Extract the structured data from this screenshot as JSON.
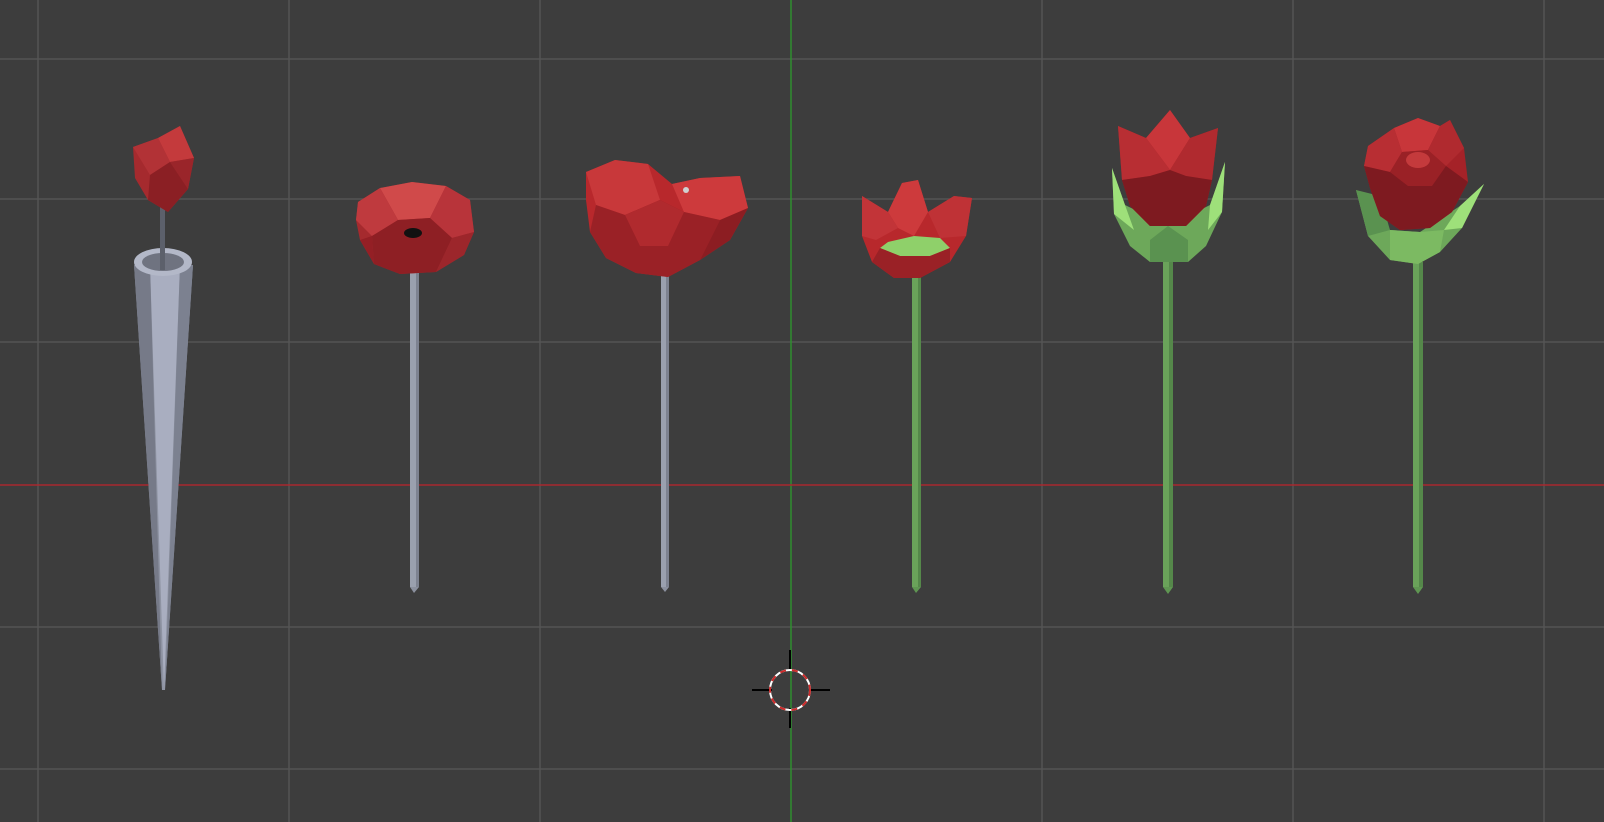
{
  "viewport": {
    "kind": "3d-viewport",
    "background_color": "#3d3d3d",
    "grid_color": "#555555",
    "x_axis_color": "#a8282f",
    "y_axis_color": "#2e8f2e",
    "cursor_color": "#cc2a2a"
  },
  "objects": [
    {
      "name": "rosebud-in-vase",
      "stem_color": "#9aa0ae",
      "bloom_color": "#a52a2e",
      "has_vase": true
    },
    {
      "name": "open-bloom-grey-stem",
      "stem_color": "#9aa0ae",
      "bloom_color": "#b0282c"
    },
    {
      "name": "wide-petal-bloom-grey-stem",
      "stem_color": "#9aa0ae",
      "bloom_color": "#b8282c"
    },
    {
      "name": "small-flower-green-stem",
      "stem_color": "#6aa35a",
      "bloom_color": "#b8282c",
      "sepal_color": "#8fd06a"
    },
    {
      "name": "tulip-green-stem",
      "stem_color": "#6aa35a",
      "bloom_color": "#a52228",
      "sepal_color": "#7fc063"
    },
    {
      "name": "rose-green-stem",
      "stem_color": "#6aa35a",
      "bloom_color": "#a52228",
      "sepal_color": "#7fc063"
    }
  ]
}
